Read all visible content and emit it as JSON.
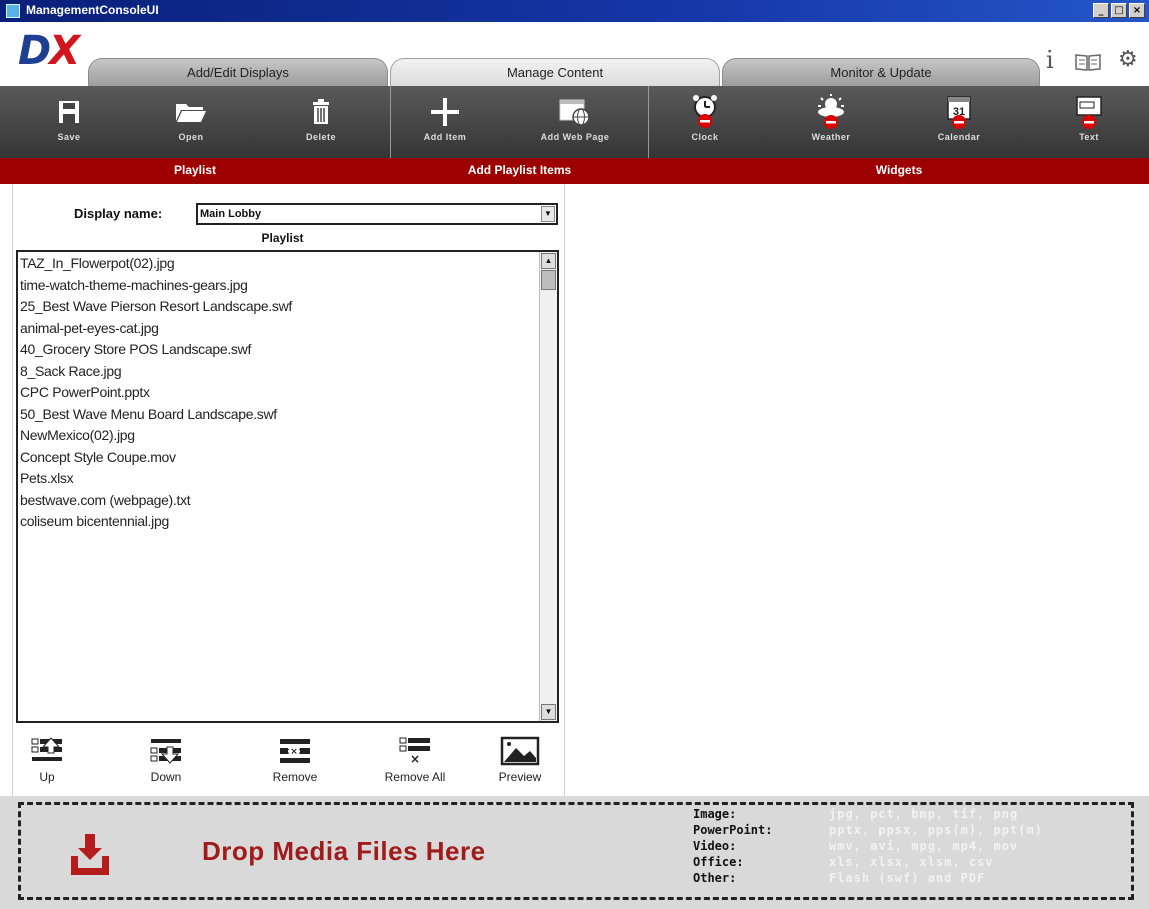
{
  "window": {
    "title": "ManagementConsoleUI",
    "controls": [
      "_",
      "□",
      "×"
    ]
  },
  "logo": {
    "d": "D",
    "x": "X"
  },
  "tabs": [
    {
      "label": "Add/Edit Displays"
    },
    {
      "label": "Manage Content",
      "active": true
    },
    {
      "label": "Monitor & Update"
    }
  ],
  "header_icons": {
    "info": "i",
    "book": "▯▯",
    "settings": "⚙"
  },
  "toolbar": {
    "playlist": {
      "label": "Playlist",
      "save": "Save",
      "open": "Open",
      "delete": "Delete"
    },
    "add_items": {
      "label": "Add Playlist Items",
      "add_item": "Add Item",
      "add_web_page": "Add Web Page"
    },
    "widgets": {
      "label": "Widgets",
      "clock": "Clock",
      "weather": "Weather",
      "calendar": "Calendar",
      "text": "Text"
    }
  },
  "display_name": {
    "label": "Display name:",
    "value": "Main Lobby"
  },
  "playlist": {
    "title": "Playlist",
    "items": [
      "TAZ_In_Flowerpot(02).jpg",
      "time-watch-theme-machines-gears.jpg",
      "25_Best Wave Pierson Resort Landscape.swf",
      "animal-pet-eyes-cat.jpg",
      "40_Grocery Store POS Landscape.swf",
      "8_Sack Race.jpg",
      "CPC PowerPoint.pptx",
      "50_Best Wave Menu Board Landscape.swf",
      "NewMexico(02).jpg",
      "Concept Style Coupe.mov",
      "Pets.xlsx",
      "bestwave.com (webpage).txt",
      "coliseum bicentennial.jpg"
    ]
  },
  "playlist_tools": {
    "up": "Up",
    "down": "Down",
    "remove": "Remove",
    "remove_all": "Remove All",
    "preview": "Preview"
  },
  "dropzone": {
    "text": "Drop Media Files Here",
    "formats": [
      {
        "key": "Image:",
        "value": "jpg, pct, bmp, tif, png"
      },
      {
        "key": "PowerPoint:",
        "value": "pptx, ppsx, pps(m), ppt(m)"
      },
      {
        "key": "Video:",
        "value": "wmv, avi, mpg, mp4, mov"
      },
      {
        "key": "Office:",
        "value": "xls, xlsx, xlsm, csv"
      },
      {
        "key": "Other:",
        "value": "Flash (swf) and PDF"
      }
    ]
  },
  "colors": {
    "accent_red": "#9c0000",
    "toolbar_dark": "#3c3c3c",
    "title_blue": "#0a1f78",
    "drop_text": "#a01c1c"
  }
}
